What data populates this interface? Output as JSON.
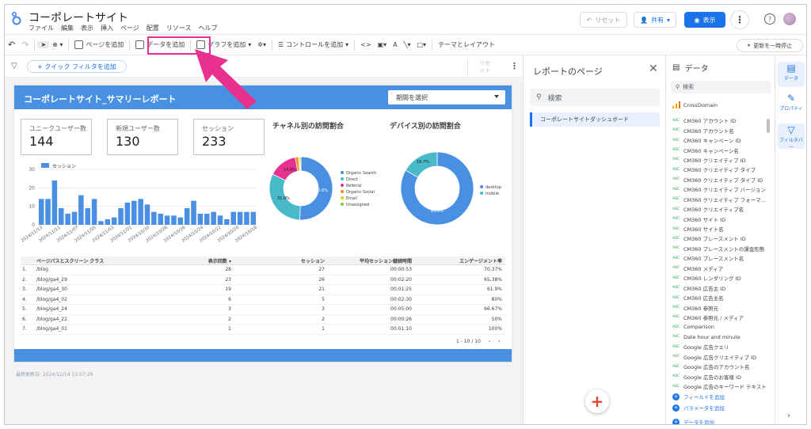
{
  "app": {
    "title": "コーポレートサイト",
    "menu": [
      "ファイル",
      "編集",
      "表示",
      "挿入",
      "ページ",
      "配置",
      "リソース",
      "ヘルプ"
    ],
    "reset_label": "リセット",
    "share_label": "共有",
    "view_label": "表示",
    "help_glyph": "?"
  },
  "toolbar": {
    "add_page": "ページを追加",
    "add_data": "データを追加",
    "add_chart": "グラフを追加",
    "add_control": "コントロールを追加",
    "theme": "テーマとレイアウト",
    "pause": "更新を一時停止"
  },
  "filterbar": {
    "quick_filter": "+ クイック フィルタを追加",
    "reset_line1": "リセ",
    "reset_line2": "ット"
  },
  "report": {
    "title": "コーポレートサイト_サマリーレポート",
    "period_placeholder": "期間を選択",
    "kpis": [
      {
        "label": "ユニークユーザー数",
        "value": "144"
      },
      {
        "label": "新規ユーザー数",
        "value": "130"
      },
      {
        "label": "セッション",
        "value": "233"
      }
    ],
    "channel_title": "チャネル別の訪問割合",
    "device_title": "デバイス別の訪問割合",
    "last_modified": "最終更新日: 2024/11/14 13:57:29",
    "pager": "1 - 10 / 10"
  },
  "chart_data": [
    {
      "type": "bar",
      "legend": "セッション",
      "ylim": [
        0,
        30
      ],
      "yticks": [
        0,
        10,
        20,
        30
      ],
      "xticks": [
        "2024/11/13",
        "2024/11/11",
        "2024/11/07",
        "2024/11/05",
        "2024/11/03",
        "2024/11/01",
        "2024/10/30",
        "2024/10/28",
        "2024/10/26",
        "2024/10/24",
        "2024/10/22",
        "2024/10/20",
        "2024/10/18"
      ],
      "values": [
        14,
        14,
        24,
        9,
        6,
        7,
        16,
        9,
        14,
        2,
        3,
        4,
        9,
        12,
        13,
        14,
        11,
        7,
        6,
        5,
        5,
        4,
        9,
        13,
        6,
        6,
        7,
        5,
        3,
        7,
        7,
        7,
        7
      ]
    },
    {
      "type": "pie",
      "title": "チャネル別の訪問割合",
      "labels": [
        "Organic Search",
        "Direct",
        "Referral",
        "Organic Social",
        "Email",
        "Unassigned"
      ],
      "values": [
        50.6,
        31.9,
        14.6,
        1.6,
        0.8,
        0.5
      ],
      "colors": [
        "#4a90e2",
        "#48b9c8",
        "#e8308e",
        "#f28b1e",
        "#f5c518",
        "#8bc34a"
      ],
      "shown_labels": [
        "50.6%",
        "31.9%",
        "14.6%"
      ]
    },
    {
      "type": "pie",
      "title": "デバイス別の訪問割合",
      "labels": [
        "desktop",
        "mobile"
      ],
      "values": [
        83.3,
        16.7
      ],
      "colors": [
        "#4a90e2",
        "#48b9c8"
      ],
      "shown_labels": [
        "83.3%",
        "16.7%"
      ]
    },
    {
      "type": "table",
      "columns": [
        "ページパスとスクリーン クラス",
        "表示回数 ▾",
        "セッション",
        "平均セッション継続時間",
        "エンゲージメント率"
      ],
      "rows": [
        [
          "1.",
          "/blog",
          "28",
          "27",
          "00:00:53",
          "70.37%"
        ],
        [
          "2.",
          "/blog/ga4_29",
          "23",
          "26",
          "00:02:20",
          "65.38%"
        ],
        [
          "3.",
          "/blog/ga4_30",
          "19",
          "21",
          "00:01:25",
          "61.9%"
        ],
        [
          "4.",
          "/blog/ga4_02",
          "6",
          "5",
          "00:02:30",
          "80%"
        ],
        [
          "5.",
          "/blog/ga4_24",
          "3",
          "3",
          "00:05:00",
          "66.67%"
        ],
        [
          "6.",
          "/blog/ga4_22",
          "2",
          "2",
          "00:00:26",
          "50%"
        ],
        [
          "7.",
          "/blog/ga4_01",
          "1",
          "1",
          "00:01:10",
          "100%"
        ]
      ]
    }
  ],
  "pages_panel": {
    "title": "レポートのページ",
    "search_placeholder": "検索",
    "item": "コーポレートサイトダッシュボード"
  },
  "data_panel": {
    "title": "データ",
    "search_placeholder": "検索",
    "source": "CrossDomain",
    "type_label": "ABC",
    "fields": [
      "CM360 アカウント ID",
      "CM360 アカウント名",
      "CM360 キャンペーン ID",
      "CM360 キャンペーン名",
      "CM360 クリエイティブ ID",
      "CM360 クリエイティブ タイプ",
      "CM360 クリエイティブ タイプ ID",
      "CM360 クリエイティブ バージョン",
      "CM360 クリエイティブ フォーマ...",
      "CM360 クリエイティブ名",
      "CM360 サイト ID",
      "CM360 サイト名",
      "CM360 プレースメント ID",
      "CM360 プレースメントの課金形態",
      "CM360 プレースメント名",
      "CM360 メディア",
      "CM360 レンダリング ID",
      "CM360 広告主 ID",
      "CM360 広告主名",
      "CM360 参照元",
      "CM360 参照元 / メディア",
      "Comparison",
      "Date hour and minute",
      "Google 広告クエリ",
      "Google 広告クリエイティブ ID",
      "Google 広告のアカウント名",
      "Google 広告のお客様 ID",
      "Google 広告のキーワード テキスト"
    ],
    "add_field": "フィールドを追加",
    "add_param": "パラメータを追加",
    "add_data": "データを追加"
  },
  "rail": {
    "data": "データ",
    "properties": "プロパティ",
    "filterbar": "フィルタバー"
  }
}
